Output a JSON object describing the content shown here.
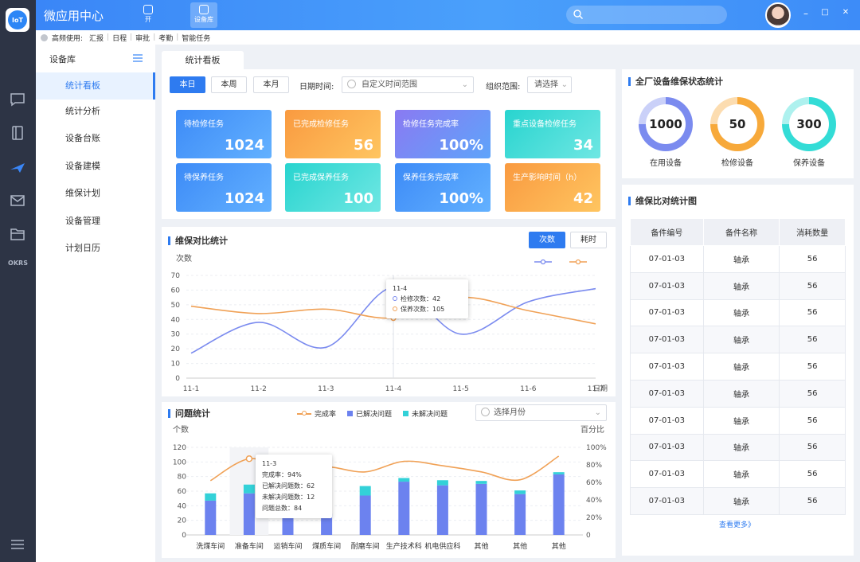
{
  "app": {
    "title": "微应用中心"
  },
  "header_tabs": [
    {
      "label": "开"
    },
    {
      "label": "设备库"
    }
  ],
  "window_controls": {
    "minimize": "–",
    "maximize": "□",
    "close": "✕"
  },
  "freq": {
    "label": "高频使用:",
    "items": [
      "汇报",
      "日程",
      "审批",
      "考勤",
      "智能任务"
    ]
  },
  "leftbar": {
    "okrs": "OKRS"
  },
  "sidebar": {
    "title": "设备库",
    "items": [
      {
        "label": "统计看板",
        "active": true
      },
      {
        "label": "统计分析"
      },
      {
        "label": "设备台账"
      },
      {
        "label": "设备建模"
      },
      {
        "label": "维保计划"
      },
      {
        "label": "设备管理"
      },
      {
        "label": "计划日历"
      }
    ]
  },
  "main": {
    "tab": "统计看板",
    "filters": {
      "buttons": [
        "本日",
        "本周",
        "本月"
      ],
      "date_label": "日期时间:",
      "date_placeholder": "自定义时间范围",
      "org_label": "组织范围:",
      "org_value": "请选择"
    },
    "tiles": [
      {
        "title": "待检修任务",
        "value": "1024"
      },
      {
        "title": "已完成检修任务",
        "value": "56"
      },
      {
        "title": "检修任务完成率",
        "value": "100%"
      },
      {
        "title": "重点设备检修任务",
        "value": "34"
      },
      {
        "title": "待保养任务",
        "value": "1024"
      },
      {
        "title": "已完成保养任务",
        "value": "100"
      },
      {
        "title": "保养任务完成率",
        "value": "100%"
      },
      {
        "title": "生产影响时间（h）",
        "value": "42"
      }
    ]
  },
  "maint_chart": {
    "title": "维保对比统计",
    "toggle": [
      "次数",
      "耗时"
    ],
    "ylabel": "次数",
    "xlabel": "日期",
    "tooltip": {
      "date": "11-4",
      "line1": "检修次数：42",
      "line2": "保养次数：105"
    }
  },
  "issue_chart": {
    "title": "问题统计",
    "legend": [
      "完成率",
      "已解决问题",
      "未解决问题"
    ],
    "month_placeholder": "选择月份",
    "ylabel_left": "个数",
    "ylabel_right": "百分比",
    "tooltip": {
      "title": "11-3",
      "l1": "完成率：94%",
      "l2": "已解决问题数：62",
      "l3": "未解决问题数：12",
      "l4": "问题总数：84"
    }
  },
  "status": {
    "title": "全厂设备维保状态统计",
    "donuts": [
      {
        "value": "1000",
        "label": "在用设备",
        "color": "#7b8bef",
        "percent": 75
      },
      {
        "value": "50",
        "label": "检修设备",
        "color": "#f7a93a",
        "percent": 75
      },
      {
        "value": "300",
        "label": "保养设备",
        "color": "#33dcd6",
        "percent": 75
      }
    ]
  },
  "parts": {
    "title": "维保比对统计图",
    "columns": [
      "备件编号",
      "备件名称",
      "消耗数量"
    ],
    "rows": [
      [
        "07-01-03",
        "轴承",
        "56"
      ],
      [
        "07-01-03",
        "轴承",
        "56"
      ],
      [
        "07-01-03",
        "轴承",
        "56"
      ],
      [
        "07-01-03",
        "轴承",
        "56"
      ],
      [
        "07-01-03",
        "轴承",
        "56"
      ],
      [
        "07-01-03",
        "轴承",
        "56"
      ],
      [
        "07-01-03",
        "轴承",
        "56"
      ],
      [
        "07-01-03",
        "轴承",
        "56"
      ],
      [
        "07-01-03",
        "轴承",
        "56"
      ],
      [
        "07-01-03",
        "轴承",
        "56"
      ]
    ],
    "more": "查看更多》"
  },
  "chart_data": [
    {
      "type": "line",
      "x": [
        "11-1",
        "11-2",
        "11-3",
        "11-4",
        "11-5",
        "11-6",
        "11-7"
      ],
      "ylim": [
        0,
        70
      ],
      "yticks": [
        0,
        10,
        20,
        30,
        40,
        50,
        60,
        70
      ],
      "xlabel": "日期",
      "ylabel": "次数",
      "grid": true,
      "series": [
        {
          "color": "#7b8bef",
          "values": [
            17,
            38,
            21,
            62,
            30,
            52,
            61
          ]
        },
        {
          "color": "#f0a156",
          "values": [
            49,
            44,
            47,
            41,
            55,
            46,
            37
          ]
        }
      ]
    },
    {
      "type": "bar",
      "categories": [
        "洗煤车间",
        "准备车间",
        "运销车间",
        "煤质车间",
        "耐磨车间",
        "生产技术科",
        "机电供应科",
        "其他",
        "其他",
        "其他"
      ],
      "ylim": [
        0,
        120
      ],
      "yticks": [
        0,
        20,
        40,
        60,
        80,
        100,
        120
      ],
      "y2lim": [
        0,
        100
      ],
      "y2ticks": [
        "0",
        "20%",
        "40%",
        "60%",
        "80%",
        "100%"
      ],
      "ylabel": "个数",
      "y2label": "百分比",
      "series": [
        {
          "name": "已解决问题",
          "color": "#6c82ef",
          "values": [
            47,
            57,
            30,
            29,
            54,
            73,
            68,
            70,
            56,
            83
          ]
        },
        {
          "name": "未解决问题",
          "color": "#33d1d8",
          "values": [
            10,
            12,
            0,
            0,
            13,
            5,
            7,
            4,
            5,
            3
          ]
        },
        {
          "name": "完成率",
          "type": "line",
          "color": "#f0a156",
          "values": [
            62,
            87,
            75,
            78,
            72,
            84,
            79,
            72,
            63,
            90
          ]
        }
      ]
    }
  ]
}
